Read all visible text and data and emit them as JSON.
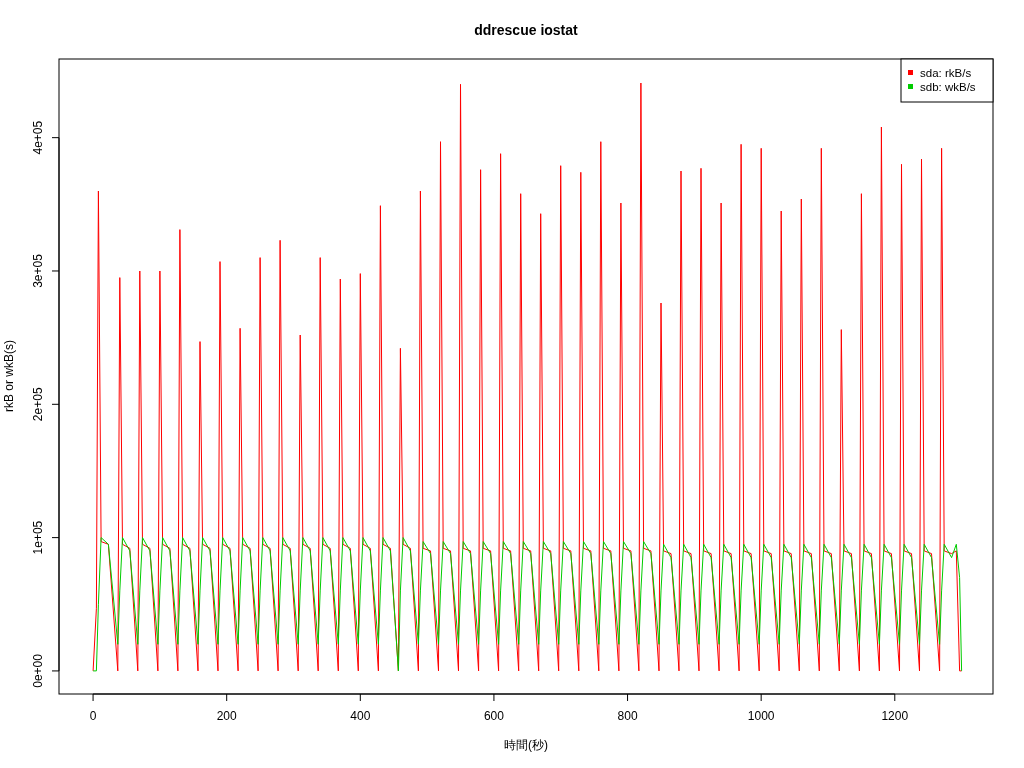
{
  "chart_data": {
    "type": "line",
    "title": "ddrescue iostat",
    "xlabel": "時間(秒)",
    "ylabel": "rkB or wkB(s)",
    "x": [
      0,
      5,
      8,
      12,
      23,
      37,
      40,
      44,
      55,
      67,
      70,
      74,
      85,
      97,
      100,
      104,
      115,
      127,
      130,
      134,
      145,
      157,
      160,
      164,
      175,
      187,
      190,
      194,
      205,
      217,
      220,
      224,
      235,
      247,
      250,
      254,
      265,
      277,
      280,
      284,
      295,
      307,
      310,
      314,
      325,
      337,
      340,
      344,
      355,
      367,
      370,
      374,
      385,
      397,
      400,
      404,
      415,
      427,
      430,
      434,
      445,
      457,
      460,
      464,
      475,
      487,
      490,
      494,
      505,
      517,
      520,
      524,
      535,
      547,
      550,
      554,
      565,
      577,
      580,
      584,
      595,
      607,
      610,
      614,
      625,
      637,
      640,
      644,
      655,
      667,
      670,
      674,
      685,
      697,
      700,
      704,
      715,
      727,
      730,
      734,
      745,
      757,
      760,
      764,
      775,
      787,
      790,
      794,
      805,
      817,
      820,
      824,
      835,
      847,
      850,
      854,
      865,
      877,
      880,
      884,
      895,
      907,
      910,
      914,
      925,
      937,
      940,
      944,
      955,
      967,
      970,
      974,
      985,
      997,
      1000,
      1004,
      1015,
      1027,
      1030,
      1034,
      1045,
      1057,
      1060,
      1064,
      1075,
      1087,
      1090,
      1094,
      1105,
      1117,
      1120,
      1124,
      1135,
      1147,
      1150,
      1154,
      1165,
      1177,
      1180,
      1184,
      1195,
      1207,
      1210,
      1214,
      1225,
      1237,
      1240,
      1244,
      1255,
      1267,
      1270,
      1274,
      1285,
      1292,
      1297,
      1300
    ],
    "series": [
      {
        "name": "sda: rkB/s",
        "color": "#ff0000",
        "values": [
          0,
          47000,
          360000,
          97000,
          95000,
          0,
          295000,
          95000,
          92000,
          0,
          300000,
          95000,
          92000,
          0,
          300000,
          95000,
          92000,
          0,
          331000,
          95000,
          92000,
          0,
          247000,
          95000,
          92000,
          0,
          307000,
          95000,
          92000,
          0,
          257000,
          95000,
          92000,
          0,
          310000,
          95000,
          92000,
          0,
          323000,
          95000,
          92000,
          0,
          252000,
          95000,
          92000,
          0,
          310000,
          95000,
          92000,
          0,
          294000,
          95000,
          92000,
          0,
          298000,
          95000,
          92000,
          0,
          349000,
          95000,
          92000,
          0,
          242000,
          95000,
          92000,
          0,
          360000,
          92000,
          90000,
          0,
          397000,
          92000,
          90000,
          0,
          440000,
          92000,
          90000,
          0,
          376000,
          92000,
          90000,
          0,
          388000,
          92000,
          90000,
          0,
          358000,
          92000,
          90000,
          0,
          343000,
          92000,
          90000,
          0,
          379000,
          92000,
          90000,
          0,
          374000,
          92000,
          90000,
          0,
          397000,
          92000,
          90000,
          0,
          351000,
          92000,
          90000,
          0,
          441000,
          92000,
          90000,
          0,
          276000,
          90000,
          88000,
          0,
          375000,
          90000,
          88000,
          0,
          377000,
          90000,
          88000,
          0,
          351000,
          90000,
          88000,
          0,
          395000,
          90000,
          88000,
          0,
          392000,
          90000,
          88000,
          0,
          345000,
          90000,
          88000,
          0,
          354000,
          90000,
          88000,
          0,
          392000,
          90000,
          88000,
          0,
          256000,
          90000,
          88000,
          0,
          358000,
          90000,
          88000,
          0,
          408000,
          90000,
          88000,
          0,
          380000,
          90000,
          88000,
          0,
          384000,
          90000,
          88000,
          0,
          392000,
          90000,
          88000,
          90000,
          0,
          0
        ]
      },
      {
        "name": "sdb: wkB/s",
        "color": "#00cc00",
        "values": [
          0,
          0,
          50000,
          100000,
          95000,
          20000,
          60000,
          100000,
          90000,
          20000,
          60000,
          100000,
          90000,
          20000,
          60000,
          100000,
          90000,
          20000,
          60000,
          100000,
          90000,
          20000,
          60000,
          100000,
          90000,
          20000,
          60000,
          100000,
          90000,
          20000,
          60000,
          100000,
          90000,
          20000,
          60000,
          100000,
          90000,
          20000,
          60000,
          100000,
          90000,
          20000,
          60000,
          100000,
          90000,
          20000,
          60000,
          100000,
          90000,
          20000,
          60000,
          100000,
          90000,
          20000,
          60000,
          100000,
          90000,
          20000,
          60000,
          100000,
          90000,
          0,
          60000,
          100000,
          90000,
          20000,
          60000,
          97000,
          88000,
          20000,
          60000,
          97000,
          88000,
          20000,
          60000,
          97000,
          88000,
          20000,
          60000,
          97000,
          88000,
          20000,
          60000,
          97000,
          88000,
          20000,
          60000,
          97000,
          88000,
          20000,
          60000,
          97000,
          88000,
          20000,
          60000,
          97000,
          88000,
          20000,
          60000,
          97000,
          88000,
          20000,
          60000,
          97000,
          88000,
          20000,
          60000,
          97000,
          88000,
          20000,
          60000,
          97000,
          88000,
          20000,
          60000,
          95000,
          85000,
          20000,
          60000,
          95000,
          85000,
          20000,
          60000,
          95000,
          85000,
          20000,
          60000,
          95000,
          85000,
          20000,
          60000,
          95000,
          85000,
          20000,
          60000,
          95000,
          85000,
          20000,
          60000,
          95000,
          85000,
          20000,
          60000,
          95000,
          85000,
          20000,
          60000,
          95000,
          85000,
          20000,
          60000,
          95000,
          85000,
          20000,
          60000,
          95000,
          85000,
          20000,
          60000,
          95000,
          85000,
          20000,
          60000,
          95000,
          85000,
          20000,
          60000,
          95000,
          85000,
          20000,
          60000,
          95000,
          85000,
          95000,
          70000,
          0
        ]
      }
    ],
    "legend": true,
    "xlim": [
      -51,
      1347
    ],
    "ylim": [
      -17300,
      459000
    ],
    "xticks": [
      0,
      200,
      400,
      600,
      800,
      1000,
      1200
    ],
    "yticks": [
      {
        "value": 0,
        "label": "0e+00"
      },
      {
        "value": 100000,
        "label": "1e+05"
      },
      {
        "value": 200000,
        "label": "2e+05"
      },
      {
        "value": 300000,
        "label": "3e+05"
      },
      {
        "value": 400000,
        "label": "4e+05"
      }
    ]
  }
}
